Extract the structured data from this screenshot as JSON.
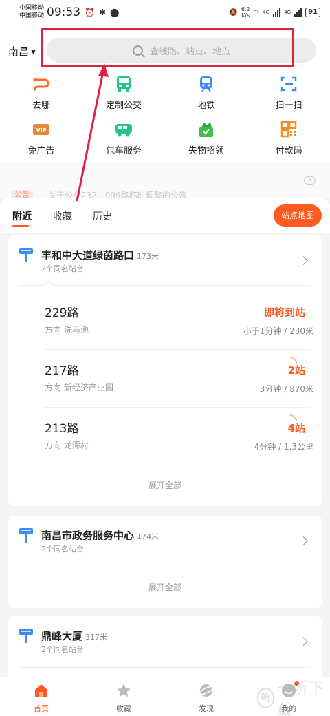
{
  "status_bar": {
    "carrier_1": "中国移动",
    "carrier_2": "中国移动",
    "time": "09:53",
    "speed": "6.2",
    "speed_unit": "K/s",
    "net_1": "4G",
    "net_2": "4G",
    "battery": "91"
  },
  "header": {
    "city": "南昌",
    "search_placeholder": "查线路、站点、地点"
  },
  "menu": [
    {
      "label": "去哪",
      "icon": "destination-icon",
      "color": "#ff6a2a"
    },
    {
      "label": "定制公交",
      "icon": "bus-icon",
      "color": "#22c38e"
    },
    {
      "label": "地铁",
      "icon": "metro-icon",
      "color": "#3b8ef0"
    },
    {
      "label": "扫一扫",
      "icon": "scan-icon",
      "color": "#3b8ef0"
    },
    {
      "label": "免广告",
      "icon": "vip-icon",
      "color": "#e08a3c"
    },
    {
      "label": "包车服务",
      "icon": "charter-bus-icon",
      "color": "#22c38e"
    },
    {
      "label": "失物招领",
      "icon": "lost-found-icon",
      "color": "#3fbf4a"
    },
    {
      "label": "付款码",
      "icon": "qr-code-icon",
      "color": "#ff8a1f"
    }
  ],
  "notice": {
    "tag": "公告",
    "text": "关于公交232、999路临时调整的公告"
  },
  "tabs": {
    "nearby": "附近",
    "favorites": "收藏",
    "history": "历史",
    "map_button": "站点地图"
  },
  "stops": [
    {
      "name": "丰和中大道绿茵路口",
      "distance": "173米",
      "same_name": "2个同名站台",
      "routes": [
        {
          "name": "229路",
          "direction": "方向 洗马池",
          "arrival": "即将到站",
          "info": "小于1分钟 / 230米"
        },
        {
          "name": "217路",
          "direction": "方向 新经济产业园",
          "arrival": "2站",
          "info": "3分钟 / 870米"
        },
        {
          "name": "213路",
          "direction": "方向 龙潭村",
          "arrival": "4站",
          "info": "4分钟 / 1.3公里"
        }
      ],
      "expand": "展开全部"
    },
    {
      "name": "南昌市政务服务中心",
      "distance": "174米",
      "same_name": "2个同名站台",
      "expand": "展开全部"
    },
    {
      "name": "鼎峰大厦",
      "distance": "317米",
      "same_name": "2个同名站台"
    }
  ],
  "bottom_nav": [
    {
      "label": "首页",
      "icon": "home-icon"
    },
    {
      "label": "收藏",
      "icon": "star-icon"
    },
    {
      "label": "发现",
      "icon": "discover-icon"
    },
    {
      "label": "我的",
      "icon": "profile-icon"
    }
  ],
  "watermark": "一听下载",
  "colors": {
    "accent": "#ff5a1f",
    "annotation": "#e0233d",
    "stop_icon": "#3b8ef0"
  }
}
